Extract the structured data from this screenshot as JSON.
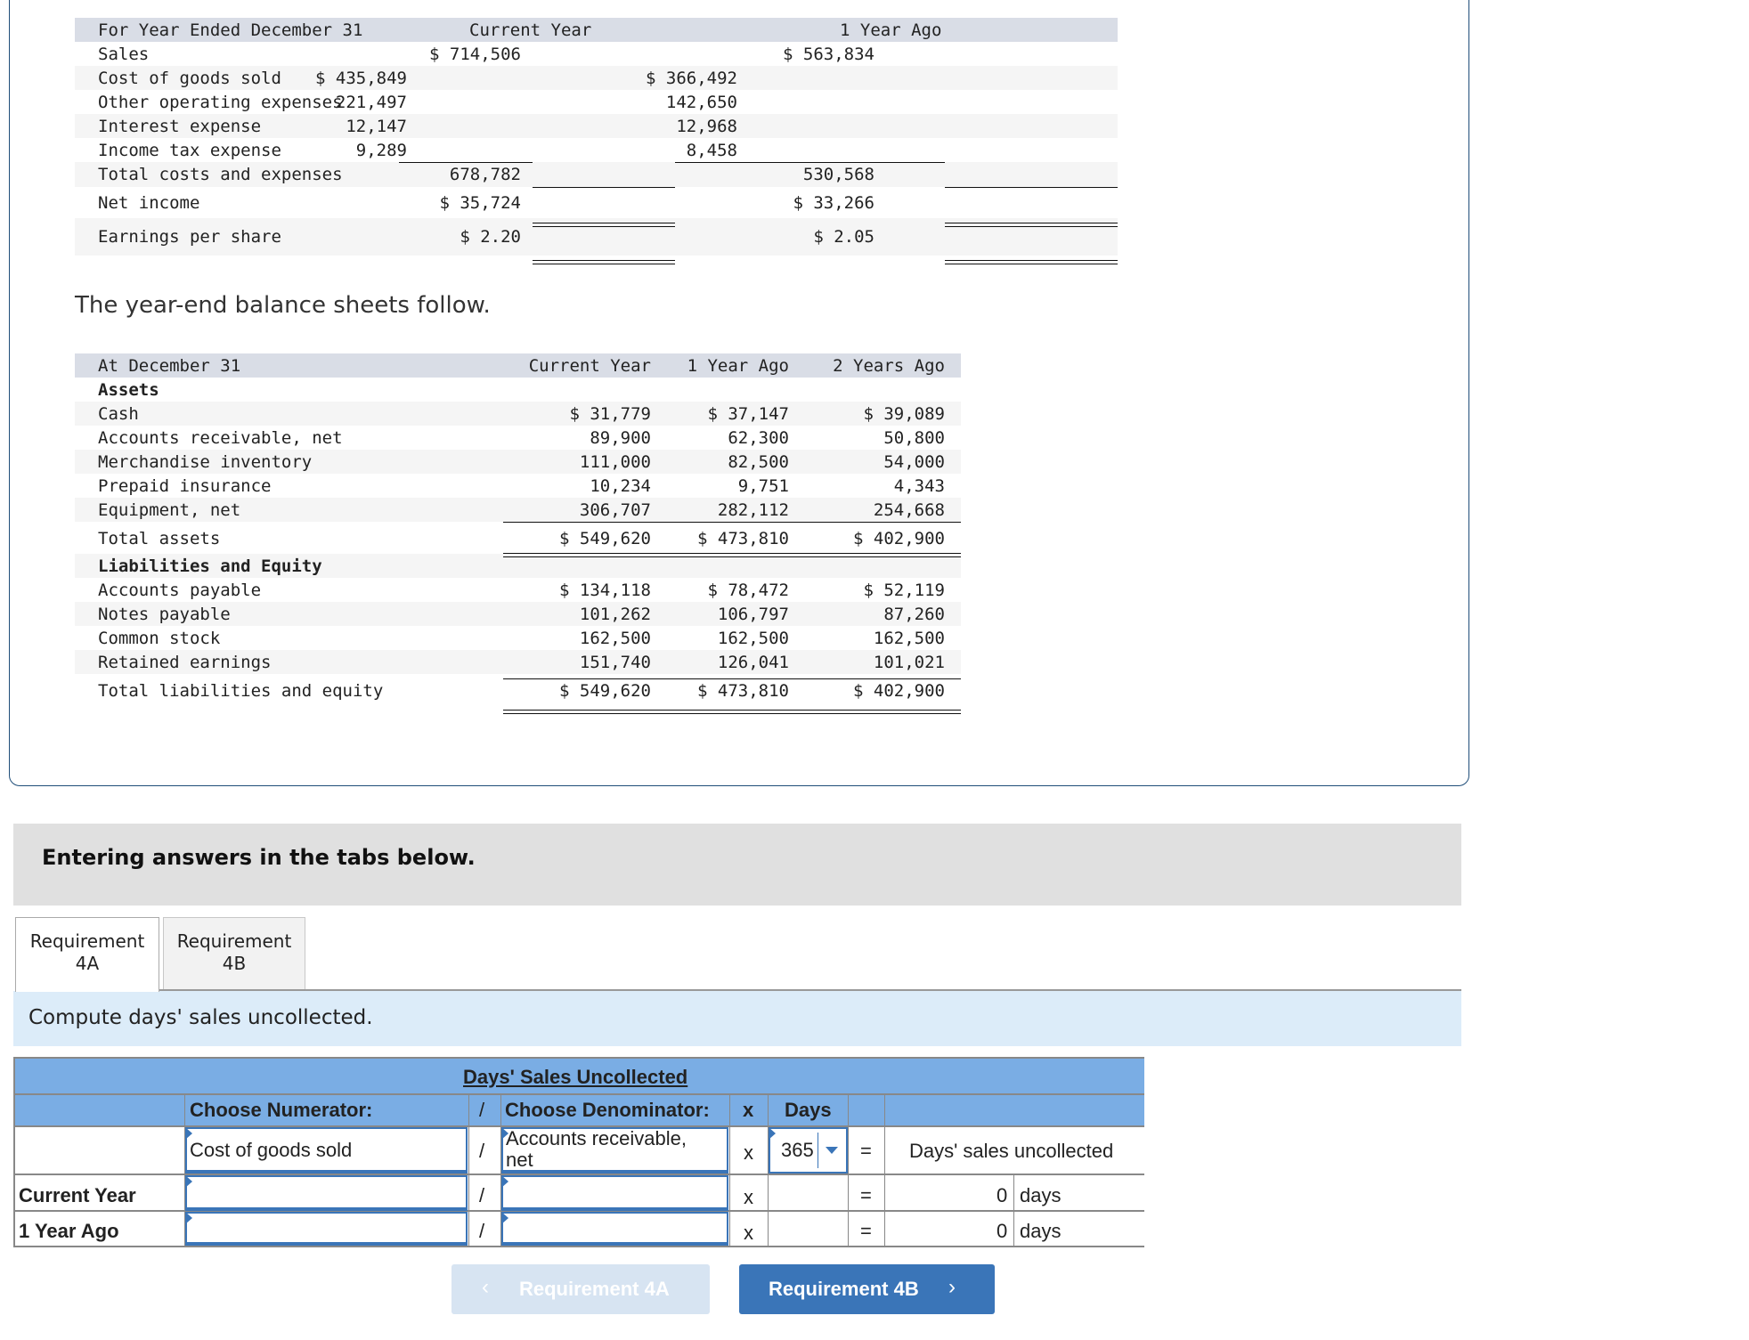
{
  "income_statement": {
    "header": {
      "label": "For Year Ended December 31",
      "current_year": "Current Year",
      "one_year_ago": "1 Year Ago"
    },
    "rows": [
      {
        "label": "Sales",
        "cy_detail": "",
        "cy_total": "$ 714,506",
        "py_detail": "",
        "py_total": "$ 563,834"
      },
      {
        "label": "Cost of goods sold",
        "cy_detail": "$ 435,849",
        "cy_total": "",
        "py_detail": "$ 366,492",
        "py_total": ""
      },
      {
        "label": "Other operating expenses",
        "cy_detail": "221,497",
        "cy_total": "",
        "py_detail": "142,650",
        "py_total": ""
      },
      {
        "label": "Interest expense",
        "cy_detail": "12,147",
        "cy_total": "",
        "py_detail": "12,968",
        "py_total": ""
      },
      {
        "label": "Income tax expense",
        "cy_detail": "9,289",
        "cy_total": "",
        "py_detail": "8,458",
        "py_total": ""
      },
      {
        "label": "Total costs and expenses",
        "cy_detail": "",
        "cy_total": "678,782",
        "py_detail": "",
        "py_total": "530,568"
      },
      {
        "label": "Net income",
        "cy_detail": "",
        "cy_total": "$ 35,724",
        "py_detail": "",
        "py_total": "$ 33,266"
      },
      {
        "label": "Earnings per share",
        "cy_detail": "",
        "cy_total": "$ 2.20",
        "py_detail": "",
        "py_total": "$ 2.05"
      }
    ]
  },
  "intro_text": "The year-end balance sheets follow.",
  "balance_sheet": {
    "header": {
      "label": "At December 31",
      "cols": [
        "Current Year",
        "1 Year Ago",
        "2 Years Ago"
      ]
    },
    "assets_heading": "Assets",
    "assets": [
      {
        "label": "Cash",
        "values": [
          "$ 31,779",
          "$ 37,147",
          "$ 39,089"
        ]
      },
      {
        "label": "Accounts receivable, net",
        "values": [
          "89,900",
          "62,300",
          "50,800"
        ]
      },
      {
        "label": "Merchandise inventory",
        "values": [
          "111,000",
          "82,500",
          "54,000"
        ]
      },
      {
        "label": "Prepaid insurance",
        "values": [
          "10,234",
          "9,751",
          "4,343"
        ]
      },
      {
        "label": "Equipment, net",
        "values": [
          "306,707",
          "282,112",
          "254,668"
        ]
      }
    ],
    "total_assets": {
      "label": "Total assets",
      "values": [
        "$ 549,620",
        "$ 473,810",
        "$ 402,900"
      ]
    },
    "liab_heading": "Liabilities and Equity",
    "liabilities": [
      {
        "label": "Accounts payable",
        "values": [
          "$ 134,118",
          "$ 78,472",
          "$ 52,119"
        ]
      },
      {
        "label": "Notes payable",
        "values": [
          "101,262",
          "106,797",
          "87,260"
        ]
      },
      {
        "label": "Common stock",
        "values": [
          "162,500",
          "162,500",
          "162,500"
        ]
      },
      {
        "label": "Retained earnings",
        "values": [
          "151,740",
          "126,041",
          "101,021"
        ]
      }
    ],
    "total_liab": {
      "label": "Total liabilities and equity",
      "values": [
        "$ 549,620",
        "$ 473,810",
        "$ 402,900"
      ]
    }
  },
  "entering_answers": "Entering answers in the tabs below.",
  "tabs": [
    {
      "label_line1": "Requirement",
      "label_line2": "4A",
      "active": true
    },
    {
      "label_line1": "Requirement",
      "label_line2": "4B",
      "active": false
    }
  ],
  "instruction": "Compute days' sales uncollected.",
  "dsu_table": {
    "title": "Days' Sales Uncollected",
    "headers": {
      "numerator": "Choose Numerator:",
      "div": "/",
      "denominator": "Choose Denominator:",
      "times": "x",
      "days": "Days"
    },
    "formula_row": {
      "numerator": "Cost of goods sold",
      "div": "/",
      "denominator_line1": "Accounts receivable,",
      "denominator_line2": "net",
      "times": "x",
      "days_value": "365",
      "equals": "=",
      "result": "Days' sales uncollected"
    },
    "rows": [
      {
        "label": "Current Year",
        "numerator": "",
        "div": "/",
        "denominator": "",
        "times": "x",
        "equals": "=",
        "value": "0",
        "unit": "days"
      },
      {
        "label": "1 Year Ago",
        "numerator": "",
        "div": "/",
        "denominator": "",
        "times": "x",
        "equals": "=",
        "value": "0",
        "unit": "days"
      }
    ]
  },
  "nav": {
    "prev_label": "Requirement 4A",
    "next_label": "Requirement 4B",
    "prev_enabled": false
  },
  "colors": {
    "table_header_blue": "#7aade4",
    "button_blue": "#3a75b8",
    "instruction_bg": "#dcecf9"
  }
}
